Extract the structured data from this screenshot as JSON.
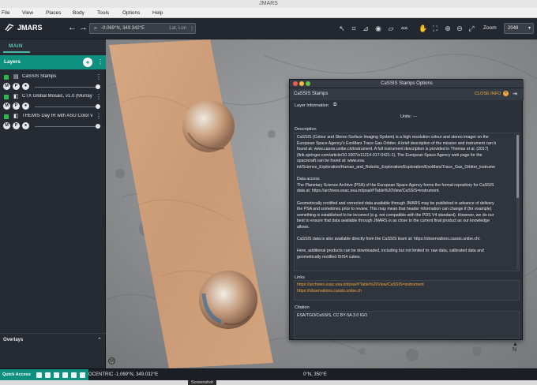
{
  "window": {
    "title": "JMARS"
  },
  "menubar": [
    "File",
    "View",
    "Places",
    "Body",
    "Tools",
    "Options",
    "Help"
  ],
  "toolbar": {
    "app_name": "JMARS",
    "coordinate_value": "-0.069°N, 349.342°E",
    "coordinate_placeholder": "Lat, Lon",
    "zoom_label": "Zoom",
    "zoom_value": "2048",
    "tools": [
      "select-arrow-icon",
      "measure-icon",
      "chart-icon",
      "eye-icon",
      "ruler-icon",
      "link-icon",
      "hand-icon",
      "fit-icon",
      "zoom-in-icon",
      "zoom-out-icon",
      "expand-icon"
    ]
  },
  "left_panel": {
    "tab": "MAIN",
    "layers_title": "Layers",
    "layers": [
      {
        "name": "CaSSIS Stamps",
        "type_icon": "stamp-icon"
      },
      {
        "name": "CTX Global Mosaic, v1.0 (Murray ...",
        "type_icon": "map-icon"
      },
      {
        "name": "THEMIS Day IR with ASU Color v1...",
        "type_icon": "map-icon"
      }
    ],
    "layer_buttons": [
      "M",
      "P"
    ],
    "overlays_title": "Overlays",
    "accent": "#0f8f7f"
  },
  "bottom_bar": {
    "quick_access": "Quick Access",
    "readout_left": "OCENTRIC  -1.069°N, 349.032°E",
    "readout_right": "0°N, 350°E",
    "tooltip": "Screenshot"
  },
  "dialog": {
    "title": "CaSSIS Stamps Options",
    "subtitle": "CaSSIS Stamps",
    "close_info": "CLOSE INFO",
    "layer_information": "Layer Information",
    "units": "Units: ---",
    "description_label": "Description",
    "description": "CaSSIS (Colour and Stereo Surface Imaging System) is a high resolution colour and stereo imager on the\nEuropean Space Agency's ExoMars Trace Gas Orbiter. A brief description of the mission and instrument can b\nfound at: www.cassis.unibe.ch/instrument. A full instrument description is provided in Thomas et al. (2017)\n(link.springer.com/article/10.1007/s11214-017-0421-1). The European Space Agency web page for the\nspacecraft can be found at: www.esa.\nint/Science_Exploration/Human_and_Robotic_Exploration/Exploration/ExoMars/Trace_Gas_Orbiter_instrume\n\nData access\nThe Planetary Science Archive (PSA) of the European Space Agency forms the formal repository for CaSSIS\ndata at: https://archives.esac.esa.int/psa/#!Table%20View/CaSSIS=instrument.\n\nGeometrically rectified and corrected data available through JMARS may be published in advance of delivery\nthe PSA and sometimes prior to review. This may mean that header information can change if (for example)\nsomething is established to be incorrect (e.g. not compatible with the PDS V4 standard). However, we do our\nbest to ensure that data available through JMARS is as close to the current final product as our knowledge\nallows.\n\nCaSSIS data is also available directly from the CaSSIS team at: https://observations.cassis.unibe.ch/.\n\nHere, additional products can be downloaded, including but not limited to: raw data, calibrated data and\ngeometrically rectified ISIS4 cubes.",
    "links_label": "Links",
    "links": [
      "https://archives.esac.esa.int/psa/#!Table%20View/CaSSIS=instrument",
      "https://observations.cassis.unibe.ch"
    ],
    "citation_label": "Citation",
    "citation": "ESA/TGO/CaSSIS, CC BY-SA 3.0 IGO"
  }
}
